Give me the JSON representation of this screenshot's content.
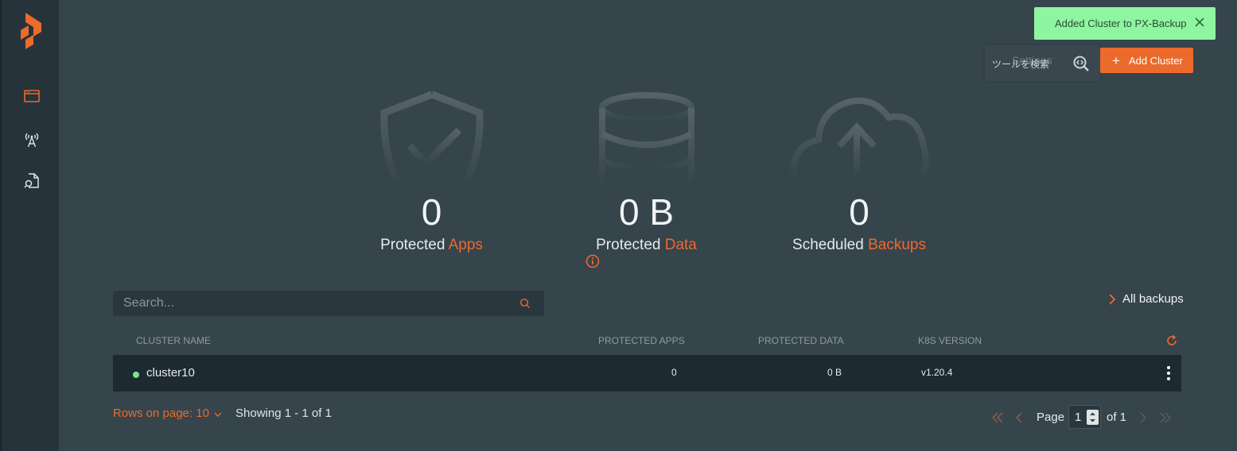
{
  "toast": {
    "message": "Added Cluster to PX-Backup",
    "color": "#8ef5a0"
  },
  "tooltip": {
    "text": "ツールを検索",
    "behind_label": "Settings"
  },
  "header": {
    "add_cluster_label": "Add Cluster",
    "accent": "#ec6a2c"
  },
  "stats": [
    {
      "value": "0",
      "caption_prefix": "Protected ",
      "caption_accent": "Apps",
      "icon": "shield-check-icon"
    },
    {
      "value": "0 B",
      "caption_prefix": "Protected ",
      "caption_accent": "Data",
      "icon": "database-icon"
    },
    {
      "value": "0",
      "caption_prefix": "Scheduled ",
      "caption_accent": "Backups",
      "icon": "cloud-upload-icon"
    }
  ],
  "search": {
    "placeholder": "Search...",
    "value": ""
  },
  "all_backups_label": "All backups",
  "table": {
    "headers": [
      "CLUSTER NAME",
      "PROTECTED APPS",
      "PROTECTED DATA",
      "K8S VERSION"
    ],
    "rows": [
      {
        "name": "cluster10",
        "status": "online",
        "protected_apps": "0",
        "protected_data": "0 B",
        "k8s_version": "v1.20.4"
      }
    ]
  },
  "pagination": {
    "rows_on_page_label": "Rows on page: 10",
    "showing": "Showing 1 - 1 of 1",
    "page_label": "Page",
    "page_value": "1",
    "of_label": "of 1"
  }
}
